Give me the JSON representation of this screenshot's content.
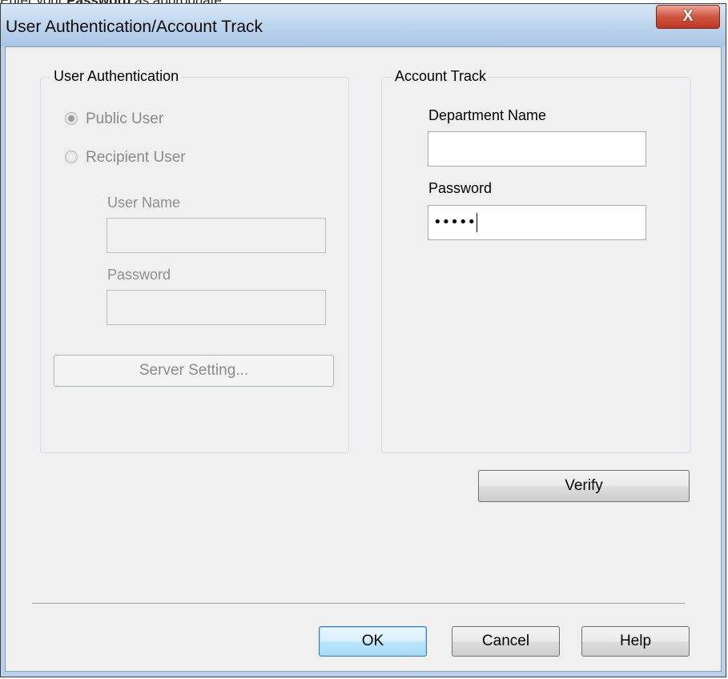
{
  "caption": {
    "prefix": "Enter your ",
    "bold": "Password",
    "suffix": " as appropriate."
  },
  "window": {
    "title": "User Authentication/Account Track",
    "close_glyph": "X"
  },
  "user_authentication": {
    "legend": "User Authentication",
    "radio_public": "Public User",
    "radio_recipient": "Recipient User",
    "selected": "Public User",
    "user_name_label": "User Name",
    "user_name_value": "",
    "password_label": "Password",
    "password_value": "",
    "server_setting_button": "Server Setting..."
  },
  "account_track": {
    "legend": "Account Track",
    "department_label": "Department Name",
    "department_value": "",
    "password_label": "Password",
    "password_value": "•••••"
  },
  "buttons": {
    "verify": "Verify",
    "ok": "OK",
    "cancel": "Cancel",
    "help": "Help"
  },
  "colors": {
    "dialog_background": "#f0f0f0",
    "title_bar": "#bcd3ec",
    "close_button": "#d2543f",
    "default_button_border": "#3c7fb1"
  }
}
